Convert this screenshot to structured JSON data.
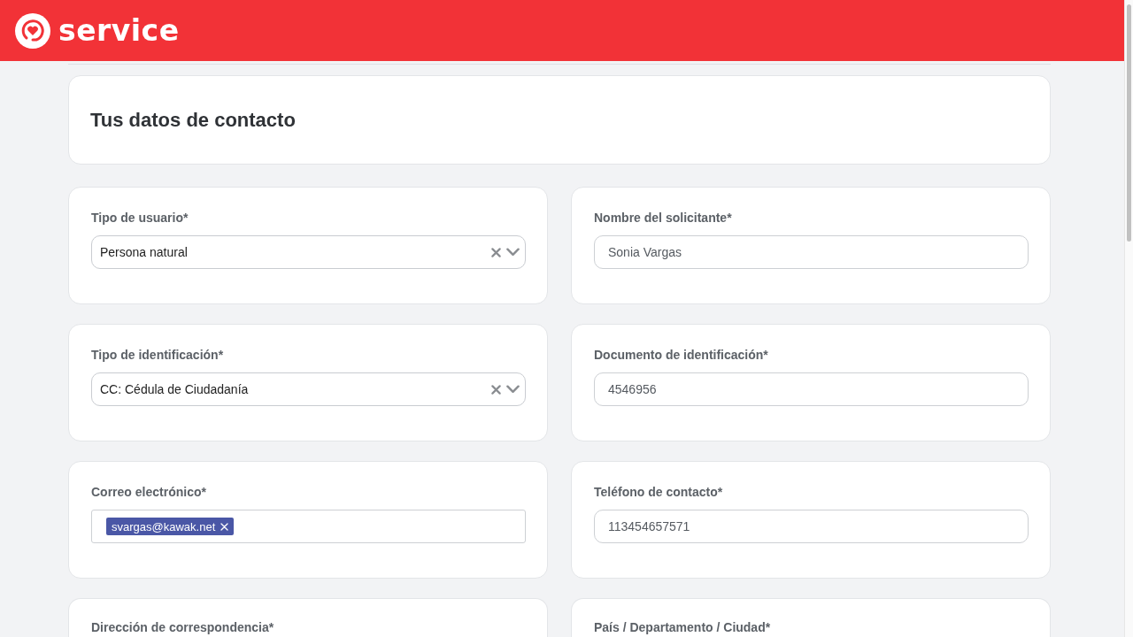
{
  "header": {
    "logo_text": "service"
  },
  "section": {
    "title": "Tus datos de contacto"
  },
  "fields": [
    {
      "kind": "select",
      "label": "Tipo de usuario*",
      "value": "Persona natural"
    },
    {
      "kind": "text",
      "label": "Nombre del solicitante*",
      "value": "Sonia Vargas"
    },
    {
      "kind": "select",
      "label": "Tipo de identificación*",
      "value": "CC: Cédula de Ciudadanía"
    },
    {
      "kind": "text",
      "label": "Documento de identificación*",
      "value": "4546956"
    },
    {
      "kind": "tags",
      "label": "Correo electrónico*",
      "tags": [
        "svargas@kawak.net"
      ]
    },
    {
      "kind": "text",
      "label": "Teléfono de contacto*",
      "value": "113454657571"
    },
    {
      "kind": "label",
      "label": "Dirección de correspondencia*"
    },
    {
      "kind": "label",
      "label": "País / Departamento / Ciudad*"
    }
  ]
}
